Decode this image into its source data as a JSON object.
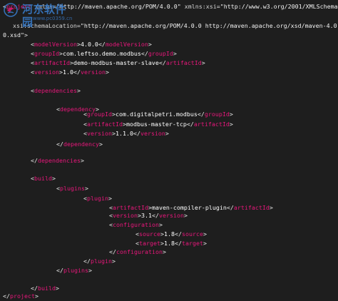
{
  "editor": {
    "lines": [
      [
        [
          "punct",
          "<"
        ],
        [
          "tag",
          "project"
        ],
        [
          "attr",
          " xmlns"
        ],
        [
          "punct",
          "="
        ],
        [
          "string",
          "\"http://maven.apache.org/POM/4.0.0\""
        ],
        [
          "attr",
          " xmlns:xsi"
        ],
        [
          "punct",
          "="
        ],
        [
          "string",
          "\"http://www.w3.org/2001/XMLSchema-insta"
        ]
      ],
      [
        [
          "attr",
          "xsi:schemaLocation"
        ],
        [
          "punct",
          "="
        ],
        [
          "string",
          "\"http://maven.apache.org/POM/4.0.0 http://maven.apache.org/xsd/maven-4.0"
        ]
      ],
      [
        [
          "string",
          "0.xsd\""
        ],
        [
          "punct",
          ">"
        ]
      ],
      [
        [
          "punct",
          "<"
        ],
        [
          "tag",
          "modelVersion"
        ],
        [
          "punct",
          ">"
        ],
        [
          "text",
          "4.0.0"
        ],
        [
          "punct",
          "</"
        ],
        [
          "tag",
          "modelVersion"
        ],
        [
          "punct",
          ">"
        ]
      ],
      [
        [
          "punct",
          "<"
        ],
        [
          "tag",
          "groupId"
        ],
        [
          "punct",
          ">"
        ],
        [
          "text",
          "com.leftso.demo.modbus"
        ],
        [
          "punct",
          "</"
        ],
        [
          "tag",
          "groupId"
        ],
        [
          "punct",
          ">"
        ]
      ],
      [
        [
          "punct",
          "<"
        ],
        [
          "tag",
          "artifactId"
        ],
        [
          "punct",
          ">"
        ],
        [
          "text",
          "demo-modbus-master-slave"
        ],
        [
          "punct",
          "</"
        ],
        [
          "tag",
          "artifactId"
        ],
        [
          "punct",
          ">"
        ]
      ],
      [
        [
          "punct",
          "<"
        ],
        [
          "tag",
          "version"
        ],
        [
          "punct",
          ">"
        ],
        [
          "text",
          "1.0"
        ],
        [
          "punct",
          "</"
        ],
        [
          "tag",
          "version"
        ],
        [
          "punct",
          ">"
        ]
      ],
      [
        [
          "punct",
          "<"
        ],
        [
          "tag",
          "dependencies"
        ],
        [
          "punct",
          ">"
        ]
      ],
      [
        [
          "punct",
          "<"
        ],
        [
          "tag",
          "dependency"
        ],
        [
          "punct",
          ">"
        ]
      ],
      [
        [
          "punct",
          "<"
        ],
        [
          "tag",
          "groupId"
        ],
        [
          "punct",
          ">"
        ],
        [
          "text",
          "com.digitalpetri.modbus"
        ],
        [
          "punct",
          "</"
        ],
        [
          "tag",
          "groupId"
        ],
        [
          "punct",
          ">"
        ]
      ],
      [
        [
          "punct",
          "<"
        ],
        [
          "tag",
          "artifactId"
        ],
        [
          "punct",
          ">"
        ],
        [
          "text",
          "modbus-master-tcp"
        ],
        [
          "punct",
          "</"
        ],
        [
          "tag",
          "artifactId"
        ],
        [
          "punct",
          ">"
        ]
      ],
      [
        [
          "punct",
          "<"
        ],
        [
          "tag",
          "version"
        ],
        [
          "punct",
          ">"
        ],
        [
          "text",
          "1.1.0"
        ],
        [
          "punct",
          "</"
        ],
        [
          "tag",
          "version"
        ],
        [
          "punct",
          ">"
        ]
      ],
      [
        [
          "punct",
          "</"
        ],
        [
          "tag",
          "dependency"
        ],
        [
          "punct",
          ">"
        ]
      ],
      [
        [
          "punct",
          "</"
        ],
        [
          "tag",
          "dependencies"
        ],
        [
          "punct",
          ">"
        ]
      ],
      [
        [
          "punct",
          "<"
        ],
        [
          "tag",
          "build"
        ],
        [
          "punct",
          ">"
        ]
      ],
      [
        [
          "punct",
          "<"
        ],
        [
          "tag",
          "plugins"
        ],
        [
          "punct",
          ">"
        ]
      ],
      [
        [
          "punct",
          "<"
        ],
        [
          "tag",
          "plugin"
        ],
        [
          "punct",
          ">"
        ]
      ],
      [
        [
          "punct",
          "<"
        ],
        [
          "tag",
          "artifactId"
        ],
        [
          "punct",
          ">"
        ],
        [
          "text",
          "maven-compiler-plugin"
        ],
        [
          "punct",
          "</"
        ],
        [
          "tag",
          "artifactId"
        ],
        [
          "punct",
          ">"
        ]
      ],
      [
        [
          "punct",
          "<"
        ],
        [
          "tag",
          "version"
        ],
        [
          "punct",
          ">"
        ],
        [
          "text",
          "3.1"
        ],
        [
          "punct",
          "</"
        ],
        [
          "tag",
          "version"
        ],
        [
          "punct",
          ">"
        ]
      ],
      [
        [
          "punct",
          "<"
        ],
        [
          "tag",
          "configuration"
        ],
        [
          "punct",
          ">"
        ]
      ],
      [
        [
          "punct",
          "<"
        ],
        [
          "tag",
          "source"
        ],
        [
          "punct",
          ">"
        ],
        [
          "text",
          "1.8"
        ],
        [
          "punct",
          "</"
        ],
        [
          "tag",
          "source"
        ],
        [
          "punct",
          ">"
        ]
      ],
      [
        [
          "punct",
          "<"
        ],
        [
          "tag",
          "target"
        ],
        [
          "punct",
          ">"
        ],
        [
          "text",
          "1.8"
        ],
        [
          "punct",
          "</"
        ],
        [
          "tag",
          "target"
        ],
        [
          "punct",
          ">"
        ]
      ],
      [
        [
          "punct",
          "</"
        ],
        [
          "tag",
          "configuration"
        ],
        [
          "punct",
          ">"
        ]
      ],
      [
        [
          "punct",
          "</"
        ],
        [
          "tag",
          "plugin"
        ],
        [
          "punct",
          ">"
        ]
      ],
      [
        [
          "punct",
          "</"
        ],
        [
          "tag",
          "plugins"
        ],
        [
          "punct",
          ">"
        ]
      ],
      [
        [
          "punct",
          "</"
        ],
        [
          "tag",
          "build"
        ],
        [
          "punct",
          ">"
        ]
      ],
      [
        [
          "punct",
          "</"
        ],
        [
          "tag",
          "project"
        ],
        [
          "punct",
          ">"
        ]
      ]
    ]
  },
  "watermark": {
    "title": "河东软件园",
    "url": "www.pc0359.cn"
  },
  "colors": {
    "background": "#1e1e1e",
    "tag": "#e8177b",
    "punct": "#e8e8e8",
    "text": "#ffffff",
    "watermark": "#3a7fd0"
  }
}
